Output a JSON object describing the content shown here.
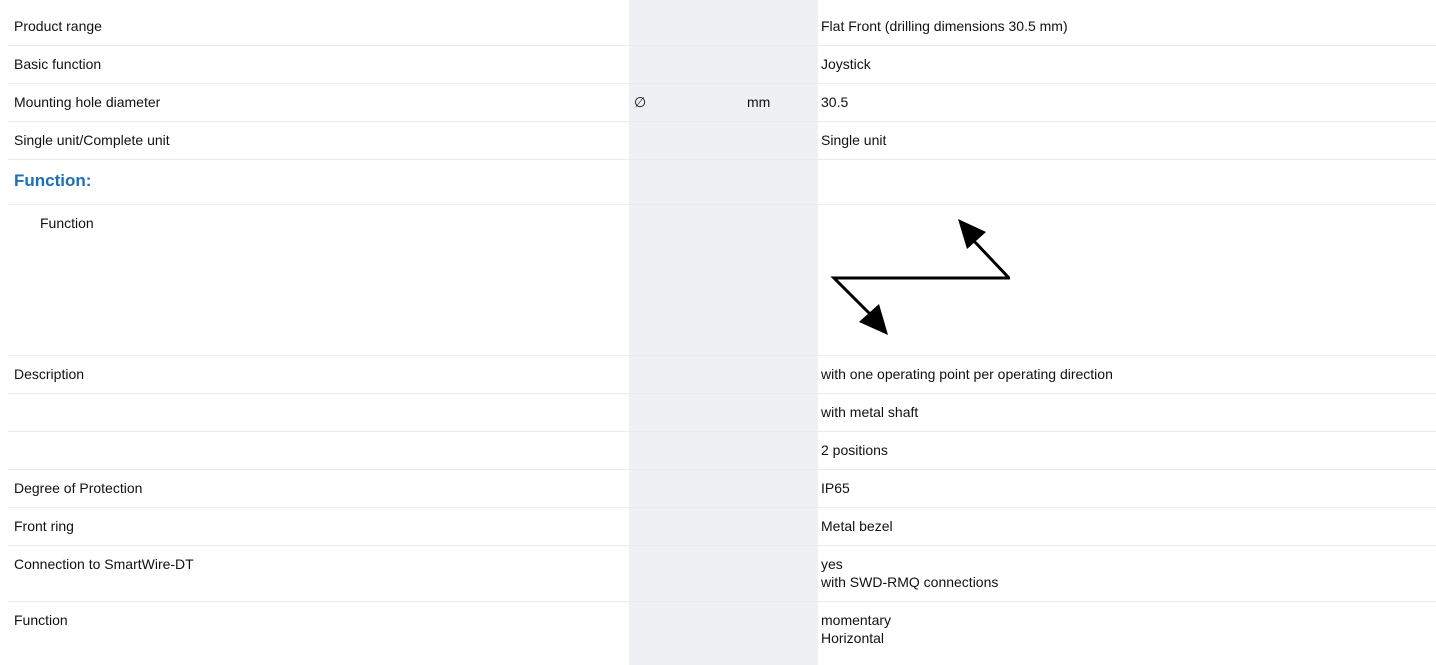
{
  "rows": [
    {
      "label": "Product range",
      "value": "Flat Front (drilling dimensions 30.5 mm)"
    },
    {
      "label": "Basic function",
      "value": "Joystick"
    },
    {
      "label": "Mounting hole diameter",
      "symbol": "∅",
      "unit": "mm",
      "value": "30.5"
    },
    {
      "label": "Single unit/Complete unit",
      "value": "Single unit"
    },
    {
      "section": "Function:"
    },
    {
      "label": "Function",
      "icon": "joystick-two-direction-arrows-icon"
    },
    {
      "label": "Description",
      "value": "with one operating point per operating direction"
    },
    {
      "label": "",
      "value": "with metal shaft"
    },
    {
      "label": "",
      "value": "2 positions"
    },
    {
      "label": "Degree of Protection",
      "value": "IP65"
    },
    {
      "label": "Front ring",
      "value": "Metal bezel"
    },
    {
      "label": "Connection to SmartWire-DT",
      "value_lines": [
        "yes",
        "with SWD-RMQ connections"
      ]
    },
    {
      "label": "Function",
      "value_lines": [
        "momentary",
        "Horizontal"
      ]
    }
  ],
  "colors": {
    "heading": "#1a6fb5",
    "unit_column_bg": "#eef0f3",
    "row_divider": "#e9ebee",
    "icon": "#000000"
  }
}
